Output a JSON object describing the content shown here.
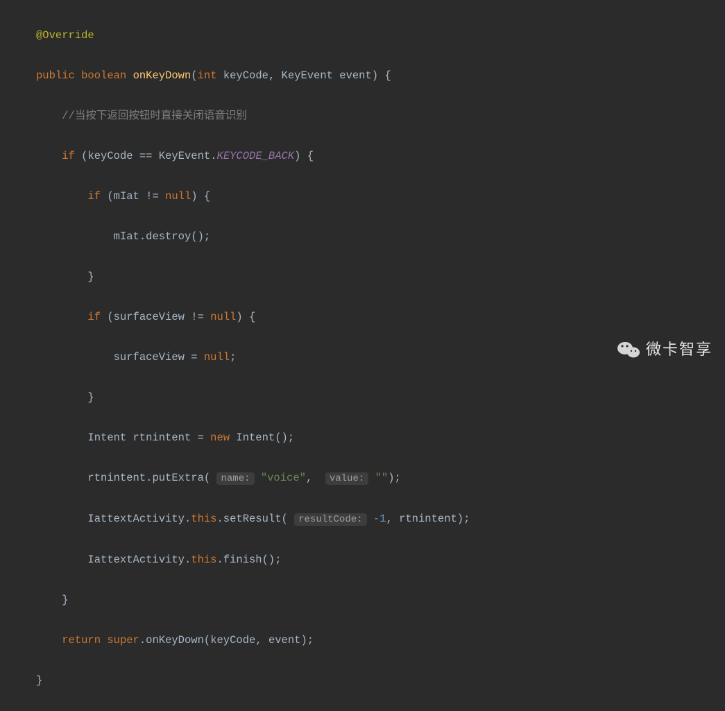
{
  "code": {
    "l1_ann": "@Override",
    "l2_kw1": "public",
    "l2_kw2": "boolean",
    "l2_name": "onKeyDown",
    "l2_kw3": "int",
    "l2_p1": "keyCode",
    "l2_cls": "KeyEvent",
    "l2_p2": "event",
    "l3_cmt": "//当按下返回按钮时直接关闭语音识别",
    "l4_kw": "if",
    "l4_var": "keyCode",
    "l4_cls": "KeyEvent",
    "l4_const": "KEYCODE_BACK",
    "l5_kw": "if",
    "l5_var": "mIat",
    "l5_null": "null",
    "l6_var": "mIat",
    "l6_call": "destroy",
    "l7_brace": "}",
    "l8_kw": "if",
    "l8_var": "surfaceView",
    "l8_null": "null",
    "l9_var": "surfaceView",
    "l9_null": "null",
    "l10_brace": "}",
    "l11_cls": "Intent",
    "l11_var": "rtnintent",
    "l11_kw": "new",
    "l11_ctor": "Intent",
    "l12_var": "rtnintent",
    "l12_call": "putExtra",
    "l12_h1": "name:",
    "l12_s1": "\"voice\"",
    "l12_h2": "value:",
    "l12_s2": "\"\"",
    "l13_cls": "IattextActivity",
    "l13_this": "this",
    "l13_call": "setResult",
    "l13_h": "resultCode:",
    "l13_num": "-1",
    "l13_arg": "rtnintent",
    "l14_cls": "IattextActivity",
    "l14_this": "this",
    "l14_call": "finish",
    "l15_brace": "}",
    "l16_kw": "return",
    "l16_kw2": "super",
    "l16_call": "onKeyDown",
    "l16_a1": "keyCode",
    "l16_a2": "event",
    "l17_brace": "}"
  },
  "watermark": {
    "text": "微卡智享"
  }
}
